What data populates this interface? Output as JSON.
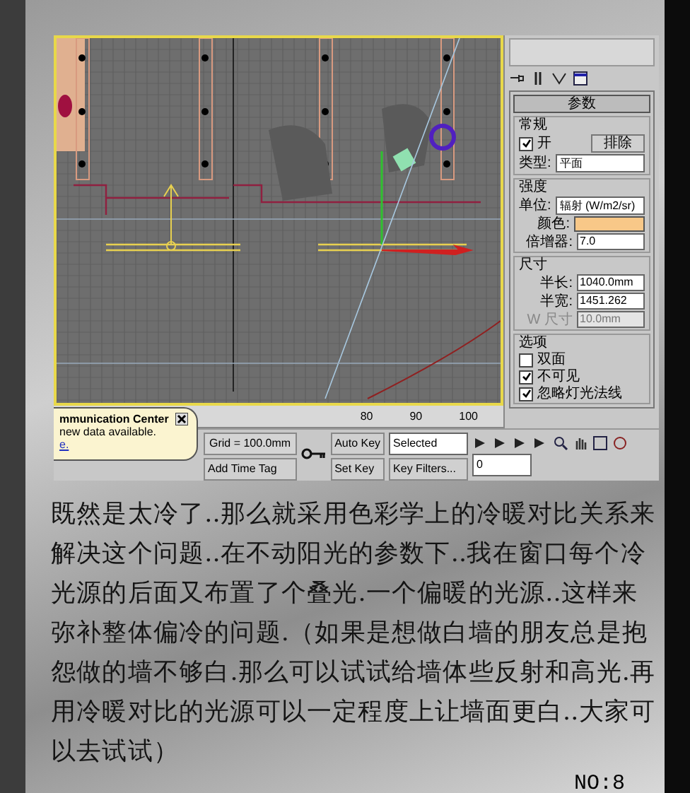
{
  "viewport": {
    "ruler_labels": [
      "80",
      "90",
      "100"
    ]
  },
  "command_panel": {
    "rollout_title": "参数",
    "groups": [
      {
        "title": "常规",
        "rows": [
          {
            "kind": "check_button",
            "label": "开",
            "checked": true,
            "button": "排除"
          },
          {
            "kind": "dropdown",
            "label": "类型:",
            "value": "平面"
          }
        ]
      },
      {
        "title": "强度",
        "rows": [
          {
            "kind": "dropdown",
            "label": "单位:",
            "value": "辐射 (W/m2/sr)"
          },
          {
            "kind": "color",
            "label": "颜色:",
            "color": "#f8c888"
          },
          {
            "kind": "spinner",
            "label": "倍增器:",
            "value": "7.0",
            "disabled": false
          }
        ]
      },
      {
        "title": "尺寸",
        "rows": [
          {
            "kind": "spinner",
            "label": "半长:",
            "value": "1040.0mm",
            "disabled": false
          },
          {
            "kind": "spinner",
            "label": "半宽:",
            "value": "1451.262",
            "disabled": false
          },
          {
            "kind": "spinner",
            "label": "W 尺寸",
            "value": "10.0mm",
            "disabled": true
          }
        ]
      },
      {
        "title": "选项",
        "rows": [
          {
            "kind": "checkbox",
            "label": "双面",
            "checked": false
          },
          {
            "kind": "checkbox",
            "label": "不可见",
            "checked": true
          },
          {
            "kind": "checkbox",
            "label": "忽略灯光法线",
            "checked": true
          }
        ]
      }
    ]
  },
  "bottom_bar": {
    "grid_readout": "Grid = 100.0mm",
    "time_tag_button": "Add Time Tag",
    "auto_key": "Auto Key",
    "key_mode": "Selected",
    "set_key": "Set Key",
    "key_filters": "Key Filters...",
    "frame": "0"
  },
  "popup": {
    "title": "mmunication Center",
    "message": "new data available.",
    "link": "e."
  },
  "article": {
    "paragraph": "既然是太冷了..那么就采用色彩学上的冷暖对比关系来解决这个问题..在不动阳光的参数下..我在窗口每个冷光源的后面又布置了个叠光.一个偏暖的光源..这样来弥补整体偏冷的问题.（如果是想做白墙的朋友总是抱怨做的墙不够白.那么可以试试给墙体些反射和高光.再用冷暖对比的光源可以一定程度上让墙面更白..大家可以去试试）",
    "page_number": "NO:8"
  }
}
